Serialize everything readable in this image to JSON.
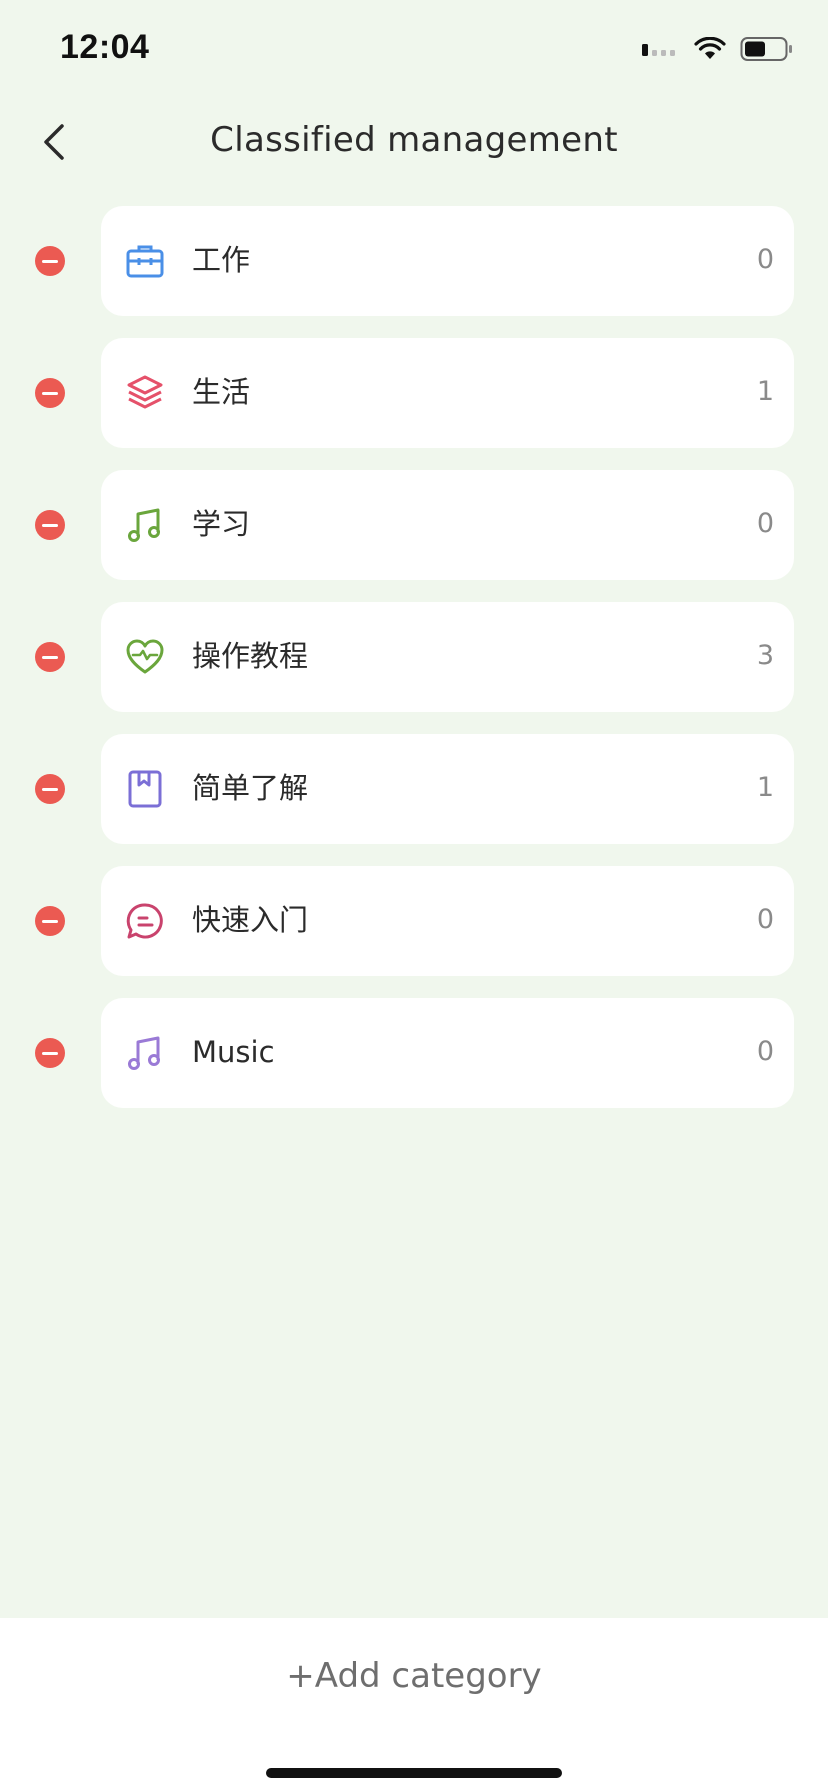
{
  "status_bar": {
    "time": "12:04"
  },
  "header": {
    "title": "Classified management"
  },
  "categories": [
    {
      "name": "工作",
      "count": "0",
      "icon": "briefcase-icon",
      "color": "#4a8fe7"
    },
    {
      "name": "生活",
      "count": "1",
      "icon": "layers-icon",
      "color": "#e5516a"
    },
    {
      "name": "学习",
      "count": "0",
      "icon": "music-note-icon",
      "color": "#6aa63c"
    },
    {
      "name": "操作教程",
      "count": "3",
      "icon": "heart-pulse-icon",
      "color": "#6aa63c"
    },
    {
      "name": "简单了解",
      "count": "1",
      "icon": "bookmark-book-icon",
      "color": "#7b6fd6"
    },
    {
      "name": "快速入门",
      "count": "0",
      "icon": "chat-bubble-icon",
      "color": "#c9436d"
    },
    {
      "name": "Music",
      "count": "0",
      "icon": "music-note-icon",
      "color": "#9a7ad6"
    }
  ],
  "footer": {
    "add_label": "+Add category"
  },
  "colors": {
    "background": "#f0f7ed",
    "delete": "#eb5a52"
  }
}
